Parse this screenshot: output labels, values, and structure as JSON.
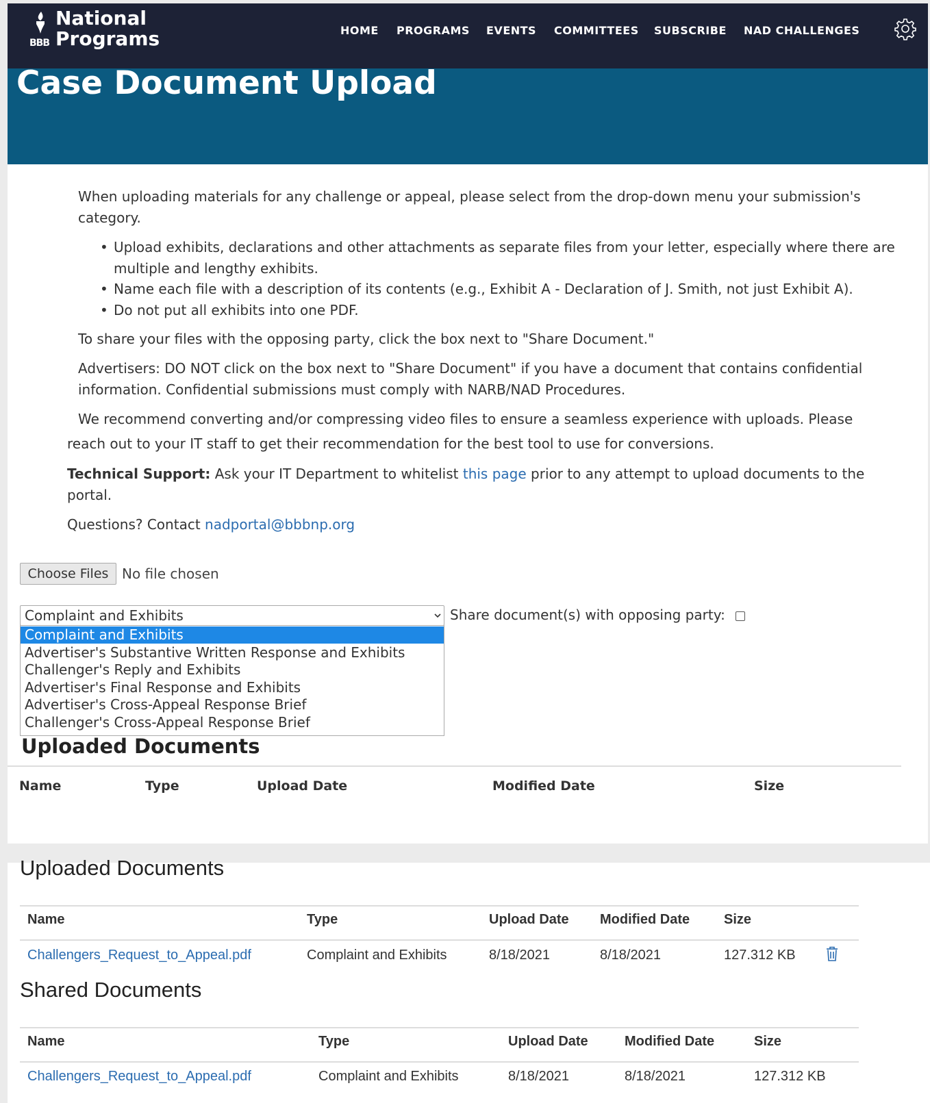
{
  "nav": {
    "logo_line1": "National",
    "logo_line2": "Programs",
    "logo_bbb": "BBB",
    "items": [
      "HOME",
      "PROGRAMS",
      "EVENTS",
      "COMMITTEES",
      "SUBSCRIBE",
      "NAD CHALLENGES"
    ],
    "settings_icon": "gear-icon"
  },
  "page_title": "Case Document Upload",
  "intro": {
    "p1_line1": "When uploading materials for any challenge or appeal, please select from the drop-down menu your submission's",
    "p1_line2": "category.",
    "bullet1_line1": "Upload exhibits, declarations and other attachments as separate files from your letter, especially where there are",
    "bullet1_line2": "multiple and lengthy exhibits.",
    "bullet2": "Name each file with a description of its contents (e.g., Exhibit A - Declaration of J. Smith, not just Exhibit A).",
    "bullet3": "Do not put all exhibits into one PDF.",
    "share_note": "To share your files with the opposing party, click the box next to \"Share Document.\"",
    "advertisers_line1": "Advertisers: DO NOT click on the box next to \"Share Document\" if you have a document that contains confidential",
    "advertisers_line2": "information. Confidential submissions must comply with NARB/NAD Procedures.",
    "video_line1": "We recommend converting and/or compressing video files to ensure a seamless experience with uploads. Please",
    "video_line2": "reach out to your IT staff to get their recommendation for the best tool to use for conversions.",
    "tech_label": "Technical Support:",
    "tech_pre": " Ask your IT Department to whitelist ",
    "tech_link": "this page",
    "tech_post": " prior to any attempt to upload documents to the",
    "tech_line2": "portal.",
    "questions_pre": "Questions? Contact ",
    "questions_email": "nadportal@bbbnp.org"
  },
  "upload": {
    "choose_label": "Choose Files",
    "no_file": "No file chosen",
    "selected": "Complaint and Exhibits",
    "options": [
      "Complaint and Exhibits",
      "Advertiser's Substantive Written Response and Exhibits",
      "Challenger's Reply and Exhibits",
      "Advertiser's Final Response and Exhibits",
      "Advertiser's Cross-Appeal Response Brief",
      "Challenger's Cross-Appeal Response Brief"
    ],
    "share_label": "Share document(s) with opposing party:",
    "share_checked": false
  },
  "top_uploaded": {
    "title": "Uploaded Documents",
    "headers": [
      "Name",
      "Type",
      "Upload Date",
      "Modified Date",
      "Size"
    ]
  },
  "uploaded": {
    "title": "Uploaded Documents",
    "headers": [
      "Name",
      "Type",
      "Upload Date",
      "Modified Date",
      "Size"
    ],
    "rows": [
      {
        "name": "Challengers_Request_to_Appeal.pdf",
        "type": "Complaint and Exhibits",
        "upload_date": "8/18/2021",
        "modified_date": "8/18/2021",
        "size": "127.312 KB"
      }
    ],
    "delete_icon": "trash-icon"
  },
  "shared": {
    "title": "Shared Documents",
    "headers": [
      "Name",
      "Type",
      "Upload Date",
      "Modified Date",
      "Size"
    ],
    "rows": [
      {
        "name": "Challengers_Request_to_Appeal.pdf",
        "type": "Complaint and Exhibits",
        "upload_date": "8/18/2021",
        "modified_date": "8/18/2021",
        "size": "127.312 KB"
      }
    ]
  },
  "colors": {
    "navbar": "#1d2236",
    "banner": "#0b5a80",
    "link": "#2b6cb0",
    "selected_option": "#1e88e5"
  }
}
